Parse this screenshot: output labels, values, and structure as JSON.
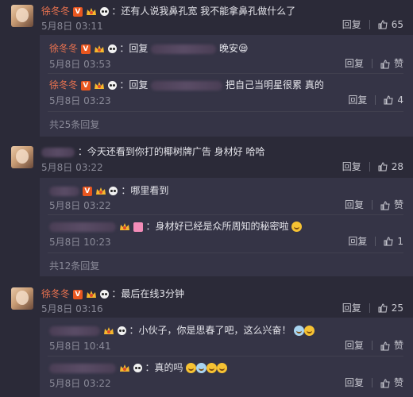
{
  "comments": [
    {
      "name": "徐冬冬",
      "text": "：还有人说我鼻孔宽 我不能拿鼻孔做什么了",
      "time": "5月8日 03:11",
      "reply_label": "回复",
      "likes": "65",
      "replies": [
        {
          "name": "徐冬冬",
          "prefix": "：回复",
          "text": "晚安😪",
          "time": "5月8日 03:53",
          "reply_label": "回复",
          "likes": "赞"
        },
        {
          "name": "徐冬冬",
          "prefix": "：回复",
          "text": "把自己当明星很累 真的",
          "time": "5月8日 03:23",
          "reply_label": "回复",
          "likes": "4"
        }
      ],
      "more_label": "共25条回复"
    },
    {
      "name": "",
      "text": "：今天还看到你打的椰树牌广告 身材好 哈哈",
      "time": "5月8日 03:22",
      "reply_label": "回复",
      "likes": "28",
      "replies": [
        {
          "name": "",
          "prefix": "：哪里看到",
          "text": "",
          "time": "5月8日 03:22",
          "reply_label": "回复",
          "likes": "赞"
        },
        {
          "name": "",
          "prefix": "：身材好已经是众所周知的秘密啦",
          "text": "",
          "time": "5月8日 10:23",
          "reply_label": "回复",
          "likes": "1"
        }
      ],
      "more_label": "共12条回复"
    },
    {
      "name": "徐冬冬",
      "text": "：最后在线3分钟",
      "time": "5月8日 03:16",
      "reply_label": "回复",
      "likes": "25",
      "replies": [
        {
          "name": "",
          "prefix": "：小伙子，你是思春了吧，这么兴奋！",
          "text": "",
          "time": "5月8日 10:41",
          "reply_label": "回复",
          "likes": "赞"
        },
        {
          "name": "",
          "prefix": "：真的吗",
          "text": "",
          "time": "5月8日 03:22",
          "reply_label": "回复",
          "likes": "赞"
        }
      ]
    }
  ],
  "icons": {
    "like": "thumbs-up-icon",
    "verified": "v-badge-icon",
    "crown": "crown-badge-icon",
    "skull": "skull-icon"
  },
  "colors": {
    "name": "#eb7350",
    "background": "#2b2a38",
    "reply_bg": "#353446"
  }
}
